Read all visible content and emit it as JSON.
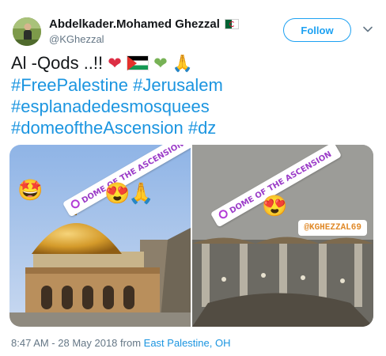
{
  "author": {
    "display_name": "Abdelkader.Mohamed Ghezzal",
    "handle": "@KGhezzal",
    "flag_icon": "algeria-flag-icon"
  },
  "follow_label": "Follow",
  "tweet": {
    "line1_text": "Al -Qods ..!!",
    "line1_emojis": [
      "red-heart",
      "palestine-flag",
      "green-heart",
      "folded-hands"
    ],
    "line2": [
      "#FreePalestine",
      "#Jerusalem"
    ],
    "line3": [
      "#esplanadedesmosquees"
    ],
    "line4": [
      "#domeoftheAscension",
      "#dz"
    ]
  },
  "media": {
    "photo1": {
      "location_sticker": "DOME OF THE ASCENSION",
      "emojis": [
        "star-struck-face",
        "heart-eyes-face",
        "folded-hands"
      ]
    },
    "photo2": {
      "location_sticker": "DOME OF THE ASCENSION",
      "emoji": "heart-eyes-face",
      "handle_sticker": "@KGHEZZAL69"
    }
  },
  "meta": {
    "time_date": "8:47 AM - 28 May 2018 from",
    "location": "East Palestine, OH"
  },
  "colors": {
    "link": "#1b95e0",
    "follow_border": "#1da1f2",
    "muted": "#657786",
    "sticker_purple": "#9b3cc8"
  }
}
